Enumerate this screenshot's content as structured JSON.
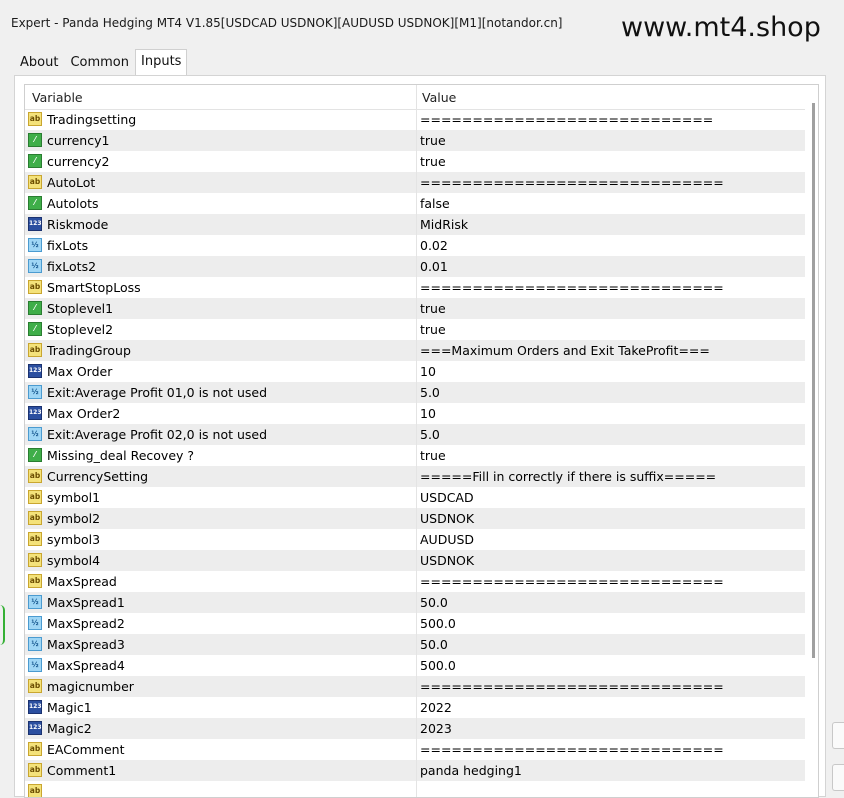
{
  "window": {
    "title": "Expert - Panda Hedging MT4 V1.85[USDCAD USDNOK][AUDUSD USDNOK][M1][notandor.cn]",
    "watermark": "www.mt4.shop"
  },
  "tabs": [
    {
      "label": "About",
      "active": false
    },
    {
      "label": "Common",
      "active": false
    },
    {
      "label": "Inputs",
      "active": true
    }
  ],
  "table": {
    "columns": [
      "Variable",
      "Value"
    ],
    "rows": [
      {
        "type": "ab",
        "name": "Tradingsetting",
        "value": "============================"
      },
      {
        "type": "bool",
        "name": "currency1",
        "value": "true"
      },
      {
        "type": "bool",
        "name": "currency2",
        "value": "true"
      },
      {
        "type": "ab",
        "name": "AutoLot",
        "value": "============================="
      },
      {
        "type": "bool",
        "name": "Autolots",
        "value": "false"
      },
      {
        "type": "int",
        "name": "Riskmode",
        "value": "MidRisk"
      },
      {
        "type": "dbl",
        "name": "fixLots",
        "value": "0.02"
      },
      {
        "type": "dbl",
        "name": "fixLots2",
        "value": "0.01"
      },
      {
        "type": "ab",
        "name": "SmartStopLoss",
        "value": "============================="
      },
      {
        "type": "bool",
        "name": "Stoplevel1",
        "value": "true"
      },
      {
        "type": "bool",
        "name": "Stoplevel2",
        "value": "true"
      },
      {
        "type": "ab",
        "name": "TradingGroup",
        "value": "===Maximum Orders and Exit TakeProfit==="
      },
      {
        "type": "int",
        "name": "Max Order",
        "value": "10"
      },
      {
        "type": "dbl",
        "name": "Exit:Average Profit 01,0 is not used",
        "value": "5.0"
      },
      {
        "type": "int",
        "name": "Max Order2",
        "value": "10"
      },
      {
        "type": "dbl",
        "name": "Exit:Average Profit 02,0 is not used",
        "value": "5.0"
      },
      {
        "type": "bool",
        "name": "Missing_deal Recovey ?",
        "value": "true"
      },
      {
        "type": "ab",
        "name": "CurrencySetting",
        "value": "=====Fill in correctly if there is suffix====="
      },
      {
        "type": "ab",
        "name": "symbol1",
        "value": "USDCAD"
      },
      {
        "type": "ab",
        "name": "symbol2",
        "value": "USDNOK"
      },
      {
        "type": "ab",
        "name": "symbol3",
        "value": "AUDUSD"
      },
      {
        "type": "ab",
        "name": "symbol4",
        "value": "USDNOK"
      },
      {
        "type": "ab",
        "name": "MaxSpread",
        "value": "============================="
      },
      {
        "type": "dbl",
        "name": "MaxSpread1",
        "value": "50.0"
      },
      {
        "type": "dbl",
        "name": "MaxSpread2",
        "value": "500.0"
      },
      {
        "type": "dbl",
        "name": "MaxSpread3",
        "value": "50.0"
      },
      {
        "type": "dbl",
        "name": "MaxSpread4",
        "value": "500.0"
      },
      {
        "type": "ab",
        "name": "magicnumber",
        "value": "============================="
      },
      {
        "type": "int",
        "name": "Magic1",
        "value": "2022"
      },
      {
        "type": "int",
        "name": "Magic2",
        "value": "2023"
      },
      {
        "type": "ab",
        "name": "EAComment",
        "value": "============================="
      },
      {
        "type": "ab",
        "name": "Comment1",
        "value": "panda hedging1"
      },
      {
        "type": "ab",
        "name": "",
        "value": ""
      }
    ]
  },
  "icons": {
    "ab": {
      "name": "string-type-icon",
      "glyph": "ab"
    },
    "bool": {
      "name": "bool-type-icon",
      "glyph": "⁄"
    },
    "int": {
      "name": "int-type-icon",
      "glyph": "123"
    },
    "dbl": {
      "name": "double-type-icon",
      "glyph": "½"
    }
  }
}
